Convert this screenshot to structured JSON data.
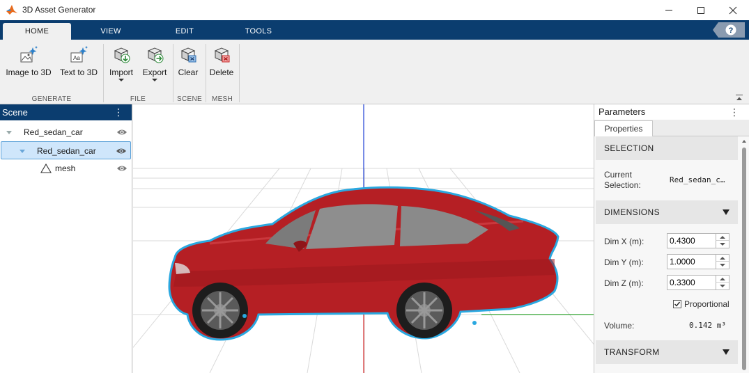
{
  "window": {
    "title": "3D Asset Generator"
  },
  "tabs": [
    {
      "label": "HOME",
      "active": true
    },
    {
      "label": "VIEW",
      "active": false
    },
    {
      "label": "EDIT",
      "active": false
    },
    {
      "label": "TOOLS",
      "active": false
    }
  ],
  "ribbon": {
    "image_to_3d": "Image to 3D",
    "text_to_3d": "Text to 3D",
    "import": "Import",
    "export": "Export",
    "clear": "Clear",
    "delete": "Delete",
    "groups": {
      "generate": "GENERATE",
      "file": "FILE",
      "scene": "SCENE",
      "mesh": "MESH"
    }
  },
  "scene": {
    "title": "Scene",
    "menu": "⋮",
    "items": [
      {
        "label": "Red_sedan_car",
        "level": 0,
        "selected": false
      },
      {
        "label": "Red_sedan_car",
        "level": 1,
        "selected": true
      },
      {
        "label": "mesh",
        "level": 2,
        "selected": false
      }
    ]
  },
  "parameters": {
    "title": "Parameters",
    "menu": "⋮",
    "tab": "Properties",
    "selection": {
      "heading": "SELECTION",
      "label": "Current Selection:",
      "value": "Red_sedan_c…"
    },
    "dimensions": {
      "heading": "DIMENSIONS",
      "dim_x_label": "Dim X (m):",
      "dim_x": "0.4300",
      "dim_y_label": "Dim Y (m):",
      "dim_y": "1.0000",
      "dim_z_label": "Dim Z (m):",
      "dim_z": "0.3300",
      "proportional_label": "Proportional",
      "proportional": true,
      "volume_label": "Volume:",
      "volume": "0.142 m³"
    },
    "transform": {
      "heading": "TRANSFORM"
    }
  },
  "colors": {
    "accent": "#0b3d6f",
    "selection_bg": "#cfe6fb",
    "car_body": "#b51f24",
    "outline": "#2aa8e0",
    "axis_x": "#d62728",
    "axis_y": "#2ca02c",
    "axis_z": "#1f3fd6"
  }
}
